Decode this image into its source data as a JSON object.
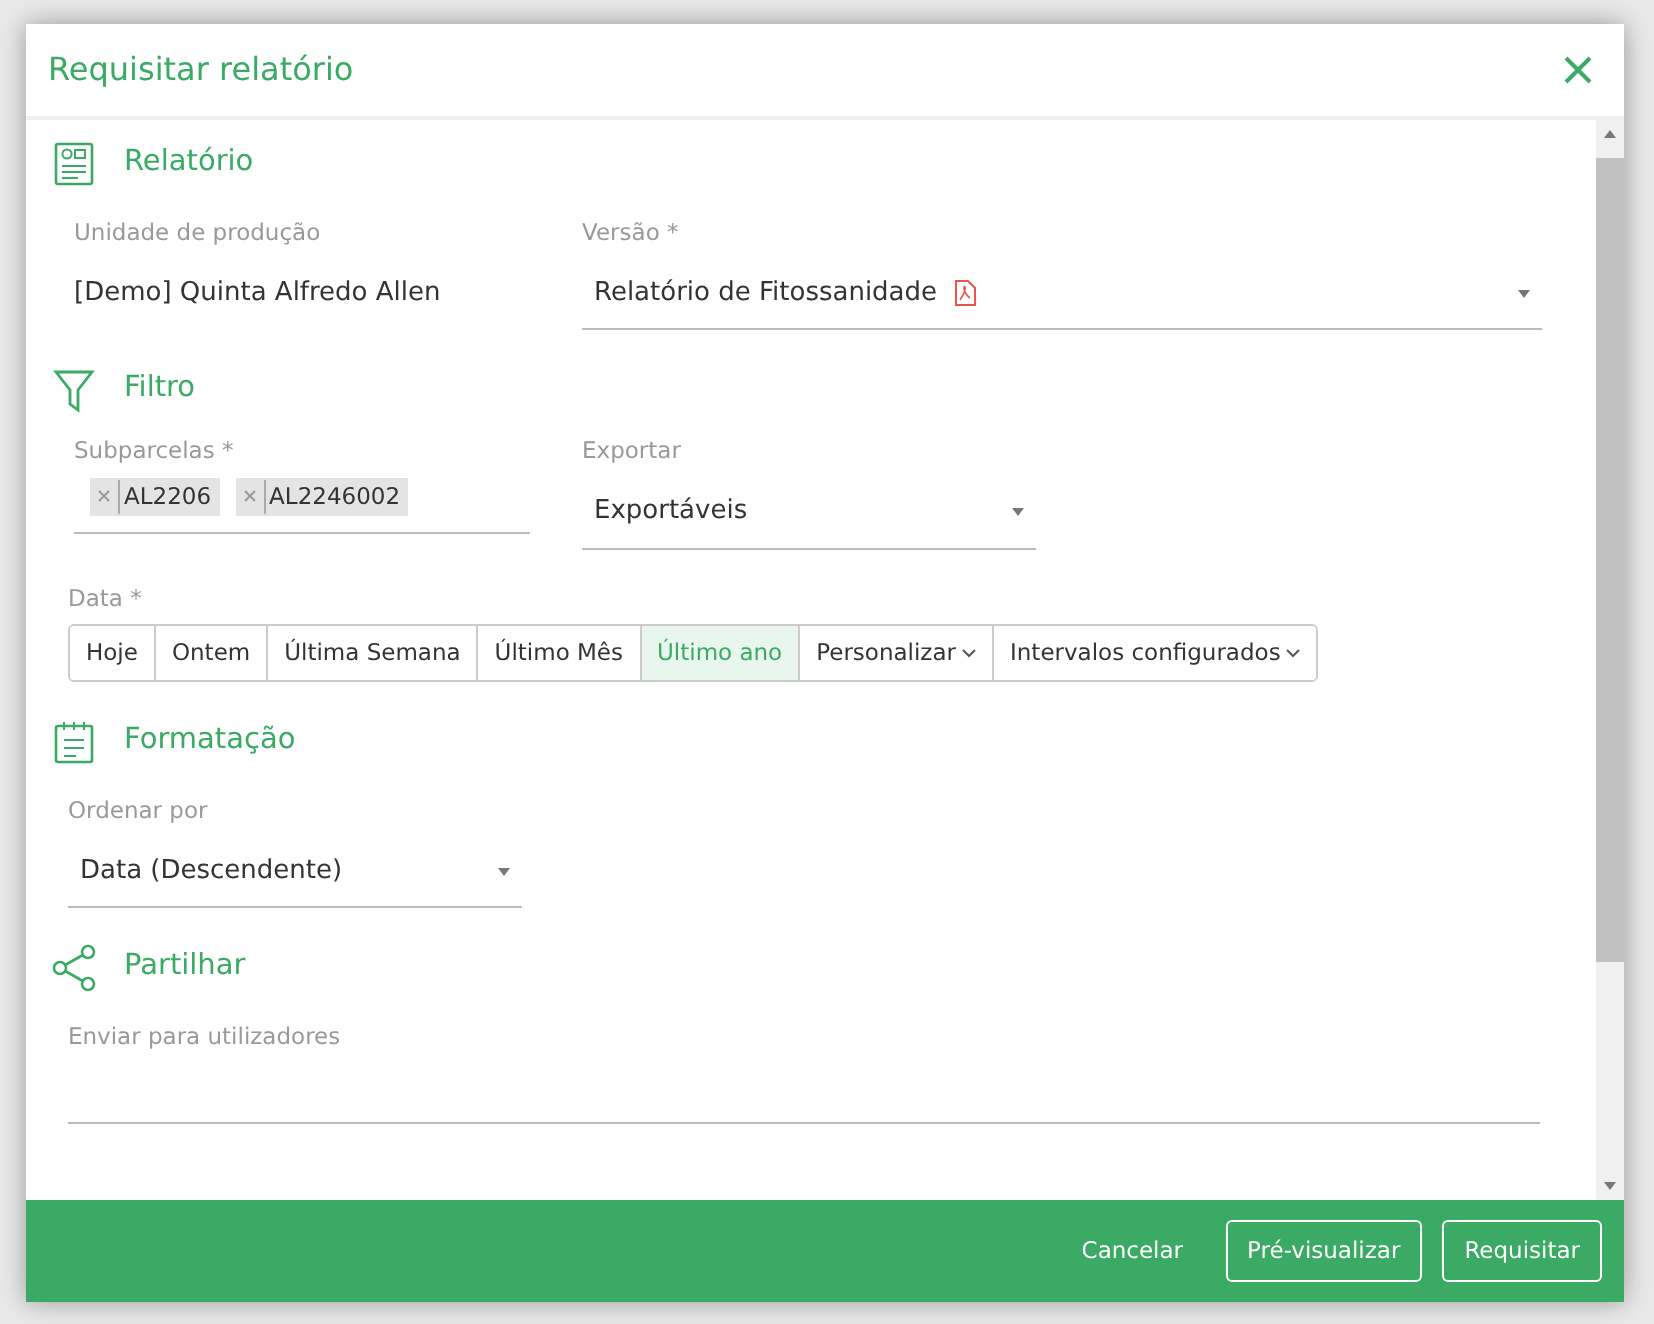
{
  "dialog": {
    "title": "Requisitar relatório"
  },
  "sections": [
    {
      "kind": "report",
      "title": "Relatório",
      "unit": {
        "label": "Unidade de produção",
        "value": "[Demo] Quinta Alfredo Allen"
      },
      "version": {
        "label": "Versão *",
        "value": "Relatório de Fitossanidade"
      }
    },
    {
      "kind": "filter",
      "title": "Filtro",
      "subplots": {
        "label": "Subparcelas *",
        "chips": [
          "AL2206",
          "AL2246002"
        ]
      },
      "export": {
        "label": "Exportar",
        "value": "Exportáveis"
      },
      "date": {
        "label": "Data *",
        "options": [
          {
            "label": "Hoje",
            "selected": false,
            "dropdown": false
          },
          {
            "label": "Ontem",
            "selected": false,
            "dropdown": false
          },
          {
            "label": "Última Semana",
            "selected": false,
            "dropdown": false
          },
          {
            "label": "Último Mês",
            "selected": false,
            "dropdown": false
          },
          {
            "label": "Último ano",
            "selected": true,
            "dropdown": false
          },
          {
            "label": "Personalizar",
            "selected": false,
            "dropdown": true
          },
          {
            "label": "Intervalos configurados",
            "selected": false,
            "dropdown": true
          }
        ]
      }
    },
    {
      "kind": "format",
      "title": "Formatação",
      "order": {
        "label": "Ordenar por",
        "value": "Data (Descendente)"
      }
    },
    {
      "kind": "share",
      "title": "Partilhar",
      "send": {
        "label": "Enviar para utilizadores"
      }
    }
  ],
  "footer": {
    "buttons": [
      {
        "label": "Cancelar",
        "kind": "link"
      },
      {
        "label": "Pré-visualizar",
        "kind": "outline"
      },
      {
        "label": "Requisitar",
        "kind": "outline"
      }
    ]
  }
}
